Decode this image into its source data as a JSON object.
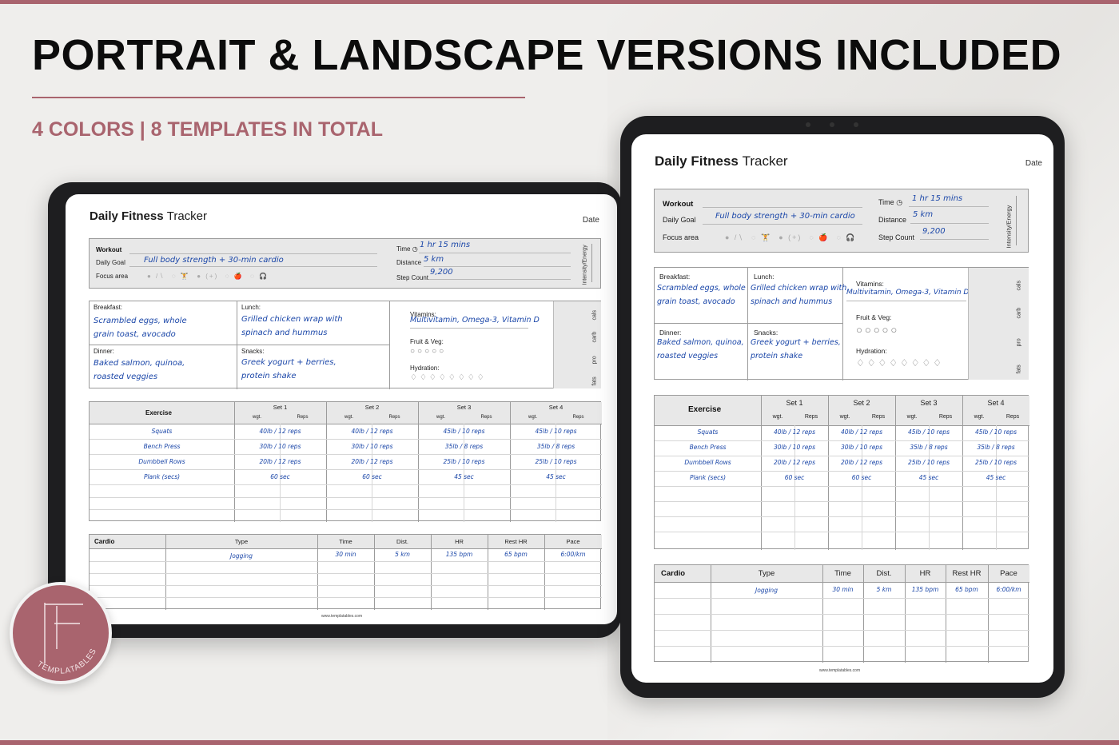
{
  "banner": {
    "headline": "PORTRAIT & LANDSCAPE VERSIONS INCLUDED",
    "subheadline": "4 COLORS | 8 TEMPLATES IN TOTAL",
    "accent_color": "#a9646e"
  },
  "logo": {
    "text": "TEMPLATABLES",
    "monogram": "TF"
  },
  "tracker": {
    "title_bold": "Daily Fitness",
    "title_light": "Tracker",
    "date_label": "Date",
    "workout_label": "Workout",
    "daily_goal_label": "Daily Goal",
    "daily_goal_value": "Full body strength + 30-min cardio",
    "focus_area_label": "Focus area",
    "time_label": "Time",
    "time_value": "1 hr 15 mins",
    "distance_label": "Distance",
    "distance_value": "5 km",
    "step_count_label": "Step Count",
    "step_count_value": "9,200",
    "intensity_label": "Intensity/Energy",
    "breakfast_label": "Breakfast:",
    "breakfast_line1": "Scrambled eggs, whole",
    "breakfast_line2": "grain toast, avocado",
    "lunch_label": "Lunch:",
    "lunch_line1": "Grilled chicken wrap with",
    "lunch_line2": "spinach and hummus",
    "dinner_label": "Dinner:",
    "dinner_line1": "Baked salmon, quinoa,",
    "dinner_line2": "roasted veggies",
    "snacks_label": "Snacks:",
    "snacks_line1": "Greek yogurt + berries,",
    "snacks_line2": "protein shake",
    "vitamins_label": "Vitamins:",
    "vitamins_value": "Multivitamin, Omega-3, Vitamin D",
    "fruit_veg_label": "Fruit & Veg:",
    "hydration_label": "Hydration:",
    "macros": [
      "cals",
      "carb",
      "pro",
      "fats"
    ],
    "exercise_header": "Exercise",
    "set_headers": [
      "Set 1",
      "Set 2",
      "Set 3",
      "Set 4"
    ],
    "wgt_label": "wgt.",
    "reps_label": "Reps",
    "exercises": [
      {
        "name": "Squats",
        "sets": [
          "40lb / 12 reps",
          "40lb / 12 reps",
          "45lb / 10 reps",
          "45lb / 10 reps"
        ]
      },
      {
        "name": "Bench Press",
        "sets": [
          "30lb / 10 reps",
          "30lb / 10 reps",
          "35lb / 8 reps",
          "35lb / 8 reps"
        ]
      },
      {
        "name": "Dumbbell Rows",
        "sets": [
          "20lb / 12 reps",
          "20lb / 12 reps",
          "25lb / 10 reps",
          "25lb / 10 reps"
        ]
      },
      {
        "name": "Plank (secs)",
        "sets": [
          "60 sec",
          "60 sec",
          "45 sec",
          "45 sec"
        ]
      }
    ],
    "cardio_headers": [
      "Cardio",
      "Type",
      "Time",
      "Dist.",
      "HR",
      "Rest HR",
      "Pace"
    ],
    "cardio_row": [
      "",
      "Jogging",
      "30 min",
      "5 km",
      "135 bpm",
      "65 bpm",
      "6:00/km"
    ],
    "footer": "www.templatables.com",
    "icons": [
      "clock-icon",
      "apple-icon",
      "drop-icon",
      "dumbbell-icon",
      "headphones-icon"
    ]
  }
}
